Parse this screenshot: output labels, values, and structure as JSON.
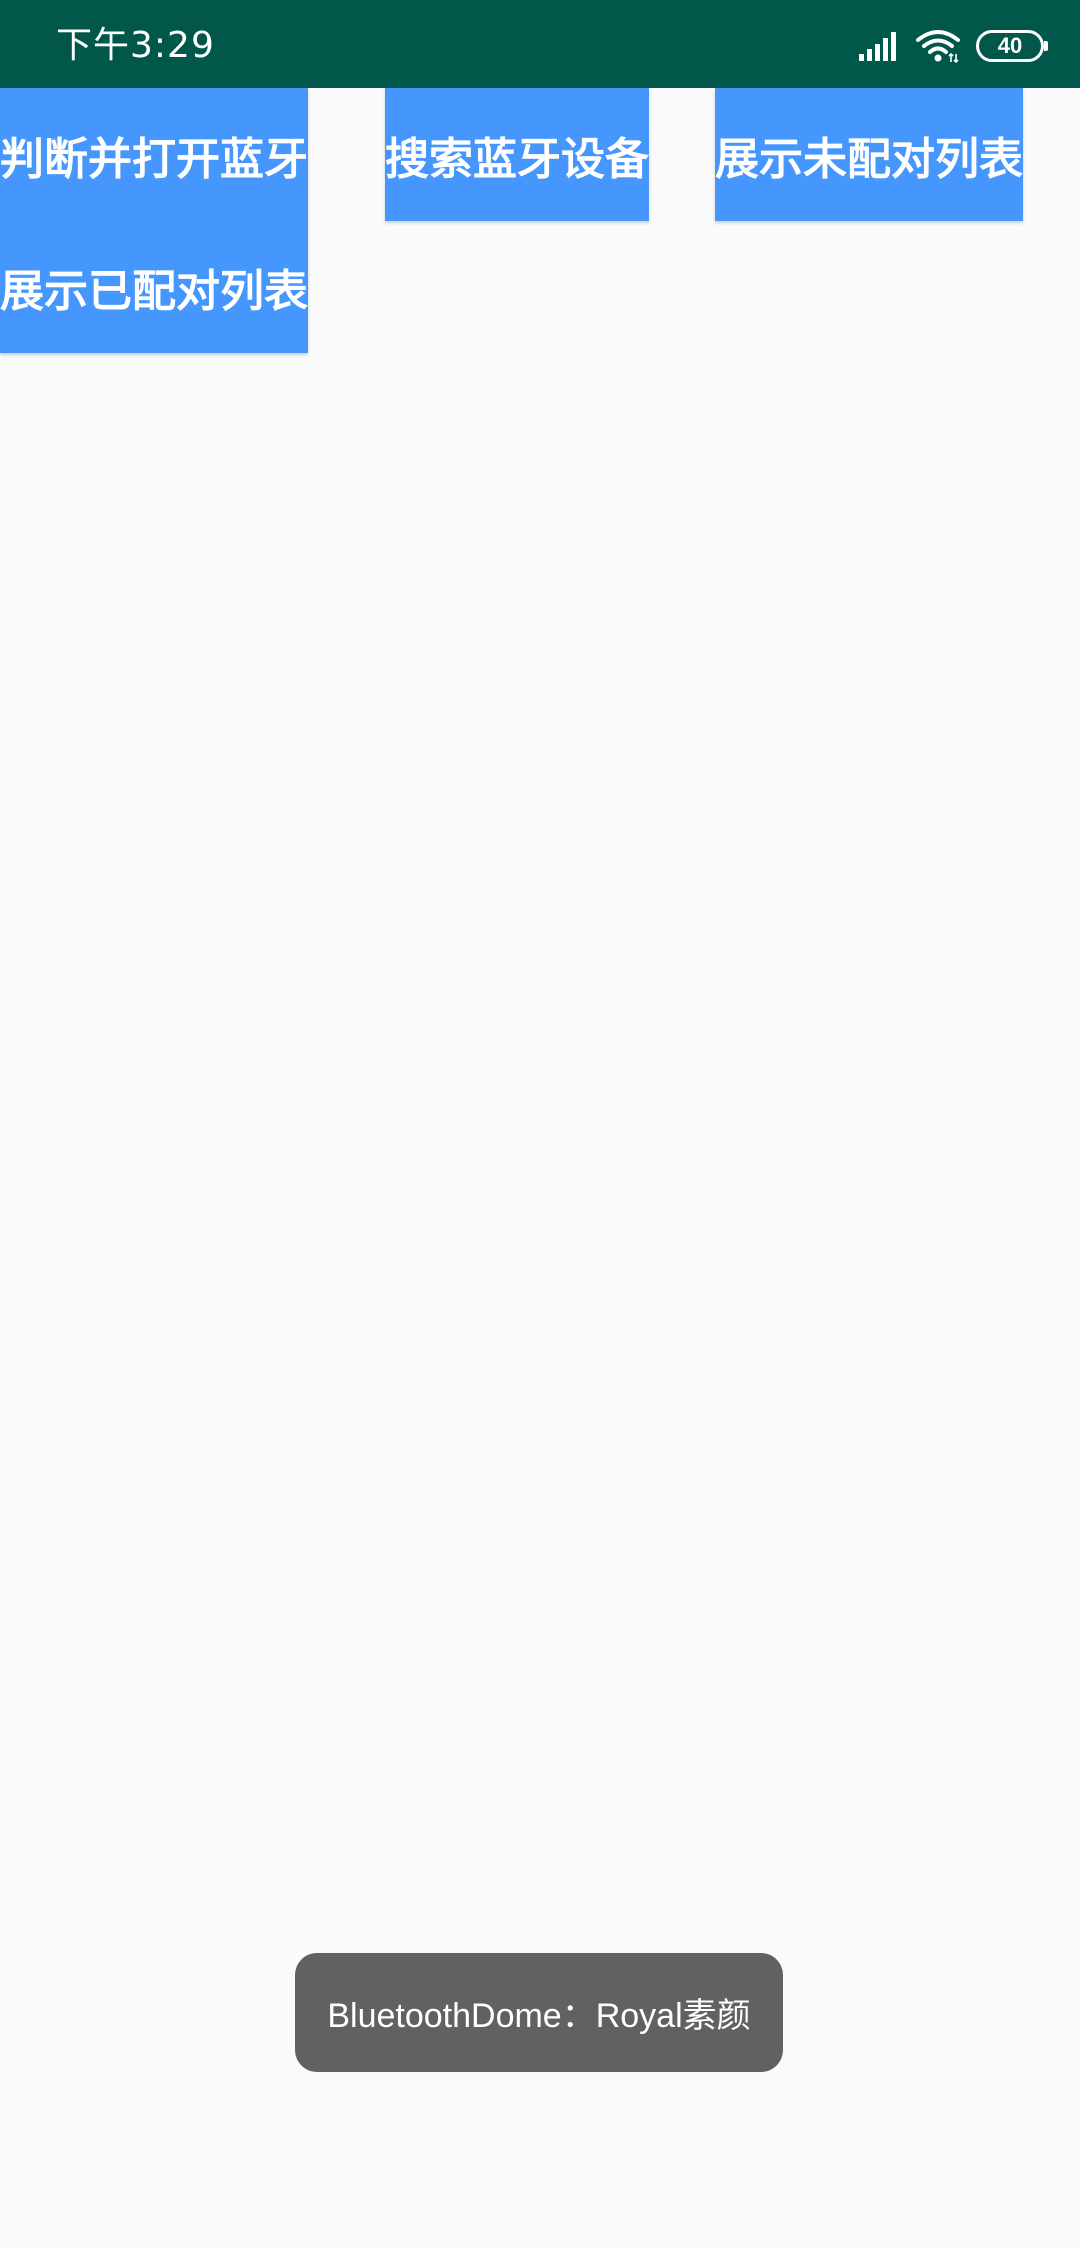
{
  "status_bar": {
    "time": "下午3:29",
    "battery_level": "40",
    "icons": [
      "signal-icon",
      "wifi-icon",
      "battery-icon"
    ],
    "background_color": "#02574b"
  },
  "buttons": {
    "open_bluetooth": "判断并打开蓝牙",
    "search_devices": "搜索蓝牙设备",
    "show_unpaired": "展示未配对列表",
    "show_paired": "展示已配对列表",
    "color": "#4596fd"
  },
  "toast": {
    "message": "BluetoothDome：Royal素颜"
  }
}
